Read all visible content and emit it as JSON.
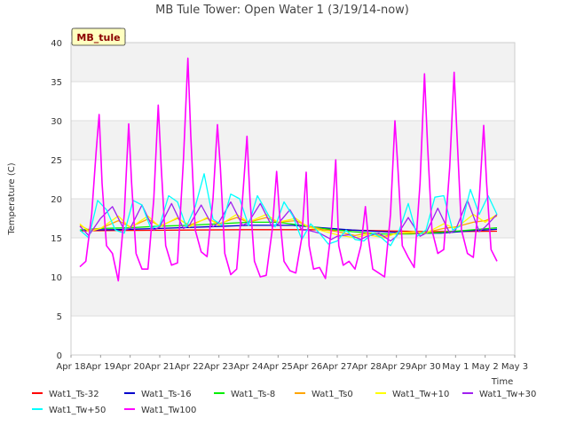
{
  "chart_data": {
    "type": "line",
    "title": "MB Tule Tower: Open Water 1 (3/19/14-now)",
    "site_label": "MB_tule",
    "ylabel": "Temperature (C)",
    "xlabel": "Time",
    "ylim": [
      0,
      40
    ],
    "xlim": [
      0,
      15
    ],
    "yticks": [
      0,
      5,
      10,
      15,
      20,
      25,
      30,
      35,
      40
    ],
    "xticks": [
      {
        "x": 0,
        "label": "Apr 18"
      },
      {
        "x": 1,
        "label": "Apr 19"
      },
      {
        "x": 2,
        "label": "Apr 20"
      },
      {
        "x": 3,
        "label": "Apr 21"
      },
      {
        "x": 4,
        "label": "Apr 22"
      },
      {
        "x": 5,
        "label": "Apr 23"
      },
      {
        "x": 6,
        "label": "Apr 24"
      },
      {
        "x": 7,
        "label": "Apr 25"
      },
      {
        "x": 8,
        "label": "Apr 26"
      },
      {
        "x": 9,
        "label": "Apr 27"
      },
      {
        "x": 10,
        "label": "Apr 28"
      },
      {
        "x": 11,
        "label": "Apr 29"
      },
      {
        "x": 12,
        "label": "Apr 30"
      },
      {
        "x": 13,
        "label": "May 1"
      },
      {
        "x": 14,
        "label": "May 2"
      },
      {
        "x": 15,
        "label": "May 3"
      }
    ],
    "grid": true,
    "legend_position": "bottom",
    "series": [
      {
        "name": "Wat1_Ts-32",
        "color": "#ff0000",
        "x": [
          0.3,
          2,
          4,
          6,
          8,
          10,
          12,
          14.4
        ],
        "y": [
          15.9,
          15.95,
          16.0,
          16.05,
          16.05,
          15.95,
          15.8,
          15.85
        ]
      },
      {
        "name": "Wat1_Ts-16",
        "color": "#0000cc",
        "x": [
          0.3,
          1.5,
          3,
          4.5,
          6,
          7.5,
          8.5,
          9.5,
          10.5,
          11.5,
          12.5,
          13.5,
          14.4
        ],
        "y": [
          16.0,
          16.05,
          16.2,
          16.4,
          16.6,
          16.6,
          16.3,
          16.0,
          15.8,
          15.6,
          15.6,
          15.9,
          16.1
        ]
      },
      {
        "name": "Wat1_Ts-8",
        "color": "#00ee00",
        "x": [
          0.3,
          1,
          2,
          3,
          4,
          5,
          6,
          7,
          7.8,
          8.5,
          9.5,
          10.5,
          11.5,
          12.5,
          13.5,
          14.4
        ],
        "y": [
          16.0,
          16.2,
          16.3,
          16.5,
          16.6,
          16.8,
          17.0,
          17.0,
          16.6,
          16.2,
          15.8,
          15.5,
          15.5,
          15.7,
          16.0,
          16.3
        ]
      },
      {
        "name": "Wat1_Ts0",
        "color": "#ffa500",
        "x": [
          0.3,
          0.6,
          1.0,
          1.6,
          2.0,
          2.6,
          3.0,
          3.6,
          4.0,
          4.6,
          5.0,
          5.6,
          6.0,
          6.6,
          7.0,
          7.6,
          8.0,
          8.6,
          9.0,
          9.6,
          10.0,
          10.6,
          11.0,
          11.6,
          12.0,
          12.6,
          13.0,
          13.6,
          14.0,
          14.4
        ],
        "y": [
          16.6,
          16.0,
          16.2,
          17.2,
          16.4,
          17.4,
          16.5,
          17.5,
          16.6,
          17.5,
          16.8,
          17.6,
          17.0,
          17.6,
          17.0,
          17.2,
          16.5,
          16.0,
          15.8,
          15.3,
          15.6,
          15.2,
          15.6,
          15.6,
          15.7,
          16.2,
          16.4,
          17.0,
          17.2,
          17.8
        ]
      },
      {
        "name": "Wat1_Tw+10",
        "color": "#ffff00",
        "x": [
          0.3,
          0.6,
          1.0,
          1.6,
          2.0,
          2.6,
          3.0,
          3.6,
          4.0,
          4.6,
          5.0,
          5.6,
          6.0,
          6.6,
          7.0,
          7.6,
          8.0,
          8.6,
          9.0,
          9.6,
          10.0,
          10.6,
          11.0,
          11.6,
          12.0,
          12.6,
          13.0,
          13.6,
          14.0,
          14.4
        ],
        "y": [
          16.8,
          15.8,
          16.2,
          17.8,
          16.3,
          17.8,
          16.4,
          17.6,
          16.4,
          17.6,
          16.6,
          18.0,
          17.0,
          18.0,
          17.0,
          17.5,
          16.4,
          15.8,
          15.4,
          15.0,
          15.4,
          15.0,
          15.6,
          15.8,
          15.6,
          16.8,
          16.2,
          18.0,
          17.0,
          18.0
        ]
      },
      {
        "name": "Wat1_Tw+30",
        "color": "#a020f0",
        "x": [
          0.3,
          0.6,
          1.0,
          1.4,
          1.8,
          2.0,
          2.4,
          2.8,
          3.0,
          3.4,
          3.8,
          4.0,
          4.4,
          4.8,
          5.0,
          5.4,
          5.8,
          6.0,
          6.4,
          6.8,
          7.0,
          7.4,
          7.8,
          8.0,
          8.4,
          8.8,
          9.0,
          9.4,
          9.8,
          10.0,
          10.4,
          10.8,
          11.0,
          11.4,
          11.8,
          12.0,
          12.4,
          12.8,
          13.0,
          13.4,
          13.8,
          14.0,
          14.4
        ],
        "y": [
          16.5,
          15.3,
          17.5,
          19.0,
          16.0,
          16.2,
          19.2,
          16.0,
          16.4,
          19.4,
          16.2,
          16.6,
          19.2,
          16.4,
          17.0,
          19.6,
          16.6,
          17.0,
          19.4,
          16.4,
          16.8,
          18.6,
          16.0,
          16.0,
          15.6,
          14.8,
          15.2,
          15.4,
          14.8,
          15.2,
          15.6,
          14.6,
          15.2,
          17.6,
          15.2,
          15.6,
          18.8,
          15.6,
          16.0,
          19.8,
          15.8,
          16.4,
          18.0
        ]
      },
      {
        "name": "Wat1_Tw+50",
        "color": "#00ffff",
        "x": [
          0.3,
          0.6,
          0.9,
          1.2,
          1.5,
          1.8,
          2.1,
          2.4,
          2.7,
          3.0,
          3.3,
          3.6,
          3.9,
          4.2,
          4.5,
          4.8,
          5.1,
          5.4,
          5.7,
          6.0,
          6.3,
          6.6,
          6.9,
          7.2,
          7.5,
          7.8,
          8.1,
          8.4,
          8.7,
          9.0,
          9.3,
          9.6,
          9.9,
          10.2,
          10.5,
          10.8,
          11.1,
          11.4,
          11.7,
          12.0,
          12.3,
          12.6,
          12.9,
          13.2,
          13.5,
          13.8,
          14.1,
          14.4
        ],
        "y": [
          16.0,
          15.0,
          19.8,
          18.6,
          16.0,
          15.6,
          19.8,
          19.2,
          16.2,
          16.6,
          20.4,
          19.6,
          16.4,
          19.0,
          23.2,
          17.4,
          16.6,
          20.6,
          20.0,
          16.6,
          20.4,
          18.4,
          16.4,
          19.6,
          17.8,
          14.8,
          16.8,
          15.6,
          14.2,
          14.6,
          16.0,
          14.8,
          14.6,
          15.6,
          15.0,
          14.0,
          16.0,
          19.4,
          15.2,
          16.0,
          20.2,
          20.4,
          16.0,
          16.6,
          21.2,
          18.0,
          20.4,
          18.0
        ]
      },
      {
        "name": "Wat1_Tw100",
        "color": "#ff00ff",
        "x": [
          0.3,
          0.5,
          0.7,
          0.85,
          0.95,
          1.05,
          1.2,
          1.4,
          1.6,
          1.8,
          1.95,
          2.05,
          2.2,
          2.4,
          2.6,
          2.8,
          2.95,
          3.05,
          3.2,
          3.4,
          3.6,
          3.8,
          3.95,
          4.05,
          4.2,
          4.4,
          4.6,
          4.8,
          4.95,
          5.05,
          5.2,
          5.4,
          5.6,
          5.8,
          5.95,
          6.05,
          6.2,
          6.4,
          6.6,
          6.8,
          6.95,
          7.05,
          7.2,
          7.4,
          7.6,
          7.8,
          7.95,
          8.05,
          8.2,
          8.4,
          8.6,
          8.8,
          8.95,
          9.05,
          9.2,
          9.4,
          9.6,
          9.8,
          9.95,
          10.05,
          10.2,
          10.4,
          10.6,
          10.8,
          10.95,
          11.05,
          11.2,
          11.4,
          11.6,
          11.8,
          11.95,
          12.05,
          12.2,
          12.4,
          12.6,
          12.8,
          12.95,
          13.05,
          13.2,
          13.4,
          13.6,
          13.8,
          13.95,
          14.05,
          14.2,
          14.4
        ],
        "y": [
          11.3,
          12.0,
          18.0,
          26.0,
          30.8,
          22.0,
          14.0,
          13.0,
          9.5,
          18.0,
          29.6,
          22.0,
          13.0,
          11.0,
          11.0,
          20.0,
          32.0,
          24.0,
          14.0,
          11.5,
          11.8,
          25.0,
          38.0,
          28.0,
          16.0,
          13.2,
          12.6,
          20.0,
          29.5,
          24.0,
          13.0,
          10.3,
          11.0,
          20.0,
          28.0,
          20.0,
          12.0,
          10.0,
          10.2,
          16.0,
          23.5,
          18.0,
          12.0,
          10.8,
          10.5,
          15.0,
          23.4,
          14.0,
          11.0,
          11.2,
          9.8,
          16.0,
          25.0,
          14.0,
          11.5,
          12.0,
          11.0,
          14.0,
          19.0,
          15.0,
          11.0,
          10.5,
          10.0,
          18.0,
          30.0,
          24.0,
          14.0,
          12.5,
          11.2,
          22.0,
          36.0,
          27.0,
          16.0,
          13.0,
          13.5,
          24.0,
          36.2,
          28.0,
          16.0,
          13.0,
          12.5,
          20.0,
          29.4,
          22.0,
          13.5,
          12.0
        ]
      }
    ]
  }
}
